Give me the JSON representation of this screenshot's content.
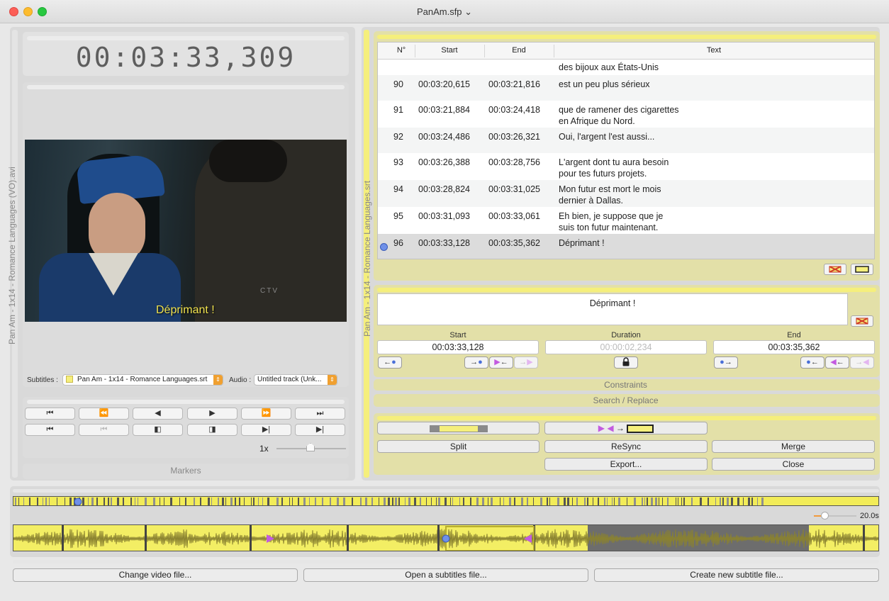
{
  "window": {
    "title": "PanAm.sfp ⌄"
  },
  "video": {
    "timecode": "00:03:33,309",
    "file_label": "Pan Am - 1x14 - Romance Languages (VO).avi",
    "subtitle_overlay": "Déprimant !",
    "watermark": "CTV"
  },
  "selectors": {
    "subtitles_label": "Subtitles :",
    "subtitles_value": "Pan Am - 1x14 - Romance Languages.srt",
    "audio_label": "Audio :",
    "audio_value": "Untitled track (Unk..."
  },
  "transport": {
    "row1": [
      "⏮",
      "⏪",
      "◀",
      "▶",
      "⏩",
      "⏭"
    ],
    "row2": [
      "⏮",
      "⏮",
      "◧",
      "◨",
      "▶|",
      "▶|"
    ],
    "speed": "1x"
  },
  "markers_label": "Markers",
  "subtitle_file": "Pan Am - 1x14 - Romance Languages.srt",
  "table": {
    "headers": [
      "N°",
      "Start",
      "End",
      "Text"
    ],
    "partial_text": "des bijoux aux États-Unis",
    "rows": [
      {
        "n": "90",
        "start": "00:03:20,615",
        "end": "00:03:21,816",
        "line1": "est un peu plus sérieux",
        "line2": ""
      },
      {
        "n": "91",
        "start": "00:03:21,884",
        "end": "00:03:24,418",
        "line1": "que de ramener des cigarettes",
        "line2": "en Afrique du Nord."
      },
      {
        "n": "92",
        "start": "00:03:24,486",
        "end": "00:03:26,321",
        "line1": "Oui, l'argent l'est aussi...",
        "line2": ""
      },
      {
        "n": "93",
        "start": "00:03:26,388",
        "end": "00:03:28,756",
        "line1": "L'argent dont tu aura besoin",
        "line2": "pour tes futurs projets."
      },
      {
        "n": "94",
        "start": "00:03:28,824",
        "end": "00:03:31,025",
        "line1": "Mon futur est mort le mois",
        "line2": "dernier à Dallas."
      },
      {
        "n": "95",
        "start": "00:03:31,093",
        "end": "00:03:33,061",
        "line1": "Eh bien, je suppose que je",
        "line2": "suis ton futur maintenant."
      },
      {
        "n": "96",
        "start": "00:03:33,128",
        "end": "00:03:35,362",
        "line1": "Déprimant !",
        "line2": ""
      }
    ]
  },
  "editor": {
    "text": "Déprimant !",
    "start_label": "Start",
    "duration_label": "Duration",
    "end_label": "End",
    "start_value": "00:03:33,128",
    "duration_value": "00:00:02,234",
    "end_value": "00:03:35,362"
  },
  "sections": {
    "constraints": "Constraints",
    "search_replace": "Search / Replace"
  },
  "actions": {
    "split": "Split",
    "resync": "ReSync",
    "merge": "Merge",
    "export": "Export...",
    "close": "Close"
  },
  "timeline": {
    "zoom": "20.0s"
  },
  "footer": {
    "change_video": "Change video file...",
    "open_subs": "Open a subtitles file...",
    "create_subs": "Create new subtitle file..."
  },
  "colors": {
    "subtitle_yellow": "#f5ef7c",
    "marker_blue": "#6f90e8",
    "marker_purple": "#c35be0"
  }
}
